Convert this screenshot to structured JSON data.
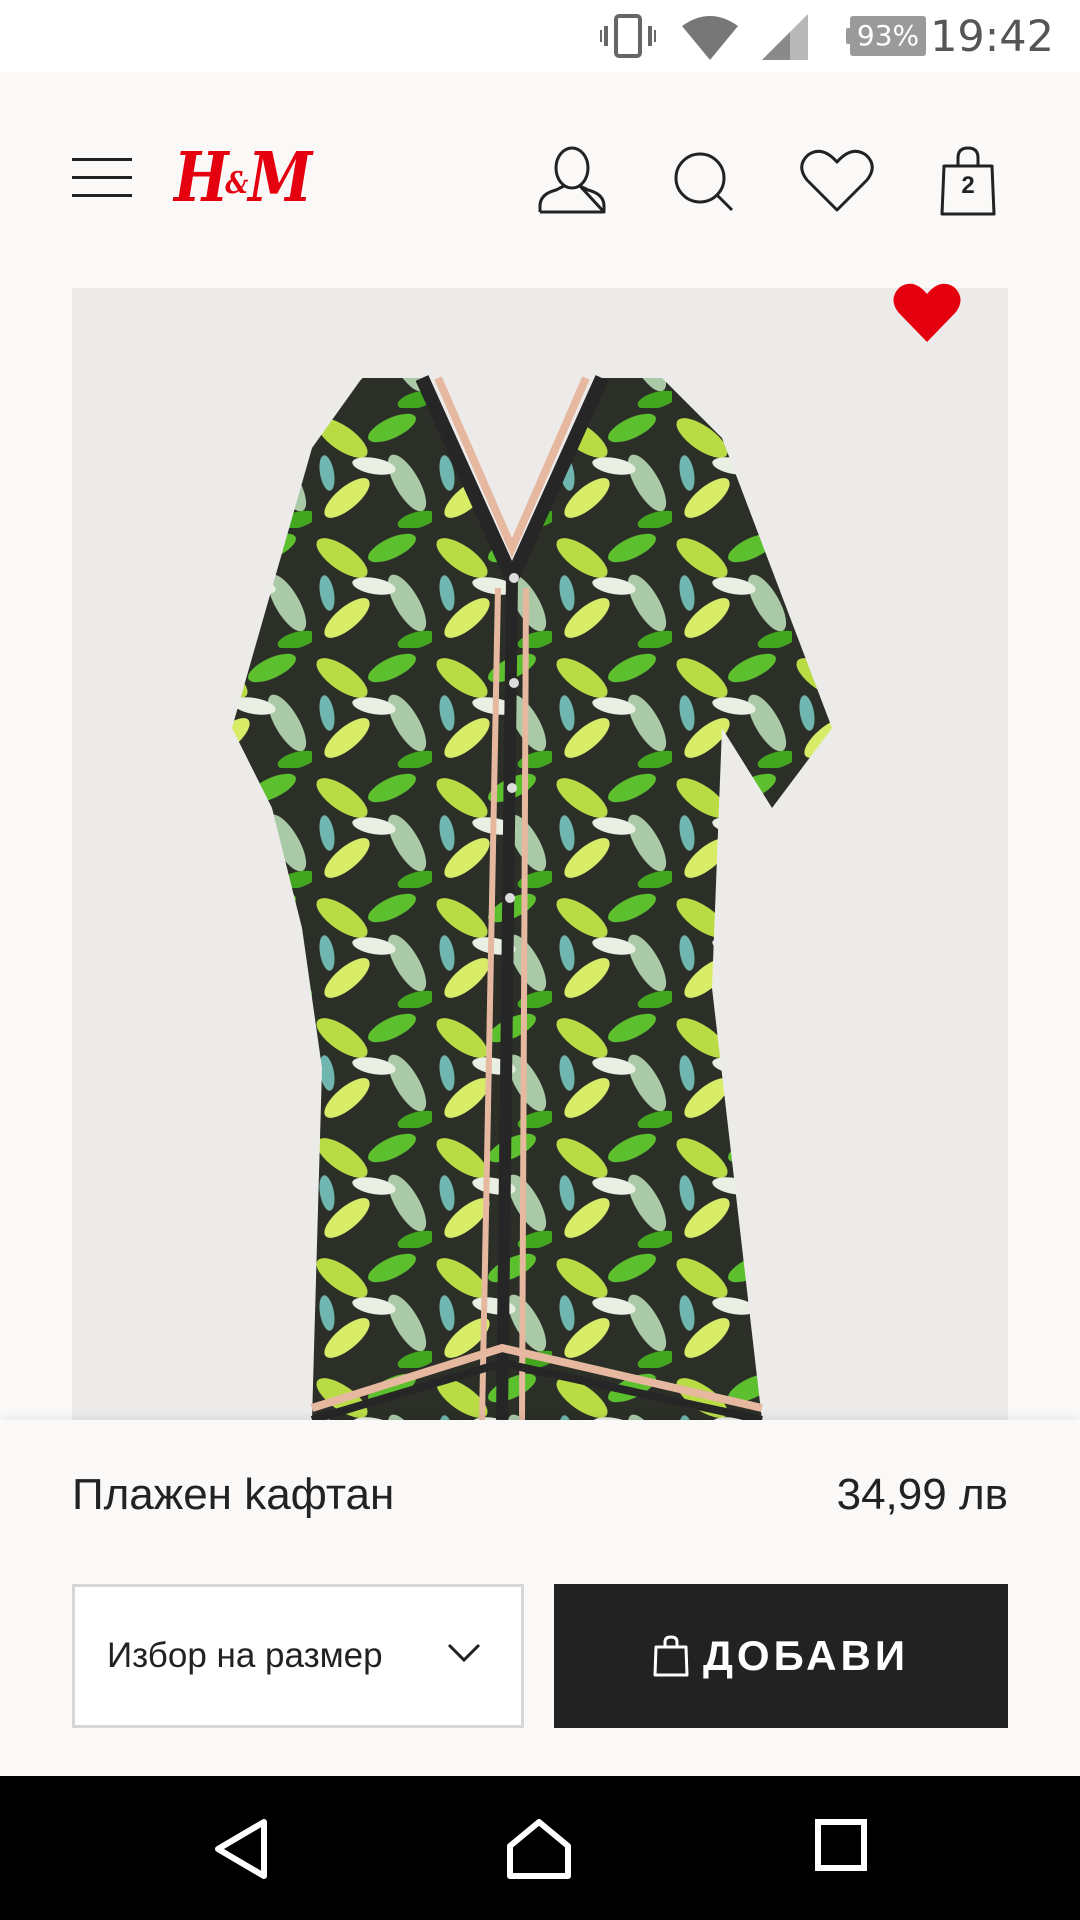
{
  "status_bar": {
    "battery_percent": "93%",
    "time": "19:42",
    "icons": [
      "vibrate-icon",
      "wifi-icon",
      "signal-icon",
      "battery-icon"
    ]
  },
  "header": {
    "logo_text": "H",
    "logo_amp": "&",
    "logo_text2": "M",
    "bag_count": "2",
    "icons": [
      "menu-icon",
      "account-icon",
      "search-icon",
      "favorites-icon",
      "shopping-bag-icon"
    ]
  },
  "product": {
    "name": "Плажен kафтан",
    "price": "34,99 лв",
    "image_alt_icon": "product-image",
    "is_favorite": true
  },
  "actions": {
    "size_select_label": "Избор на размер",
    "add_label": "ДОБАВИ"
  },
  "nav_bar": {
    "icons": [
      "back-icon",
      "home-icon",
      "recents-icon"
    ]
  },
  "colors": {
    "brand_red": "#e50010",
    "button_dark": "#222222",
    "panel_bg": "#faf9f8",
    "image_bg": "#ecebea"
  }
}
